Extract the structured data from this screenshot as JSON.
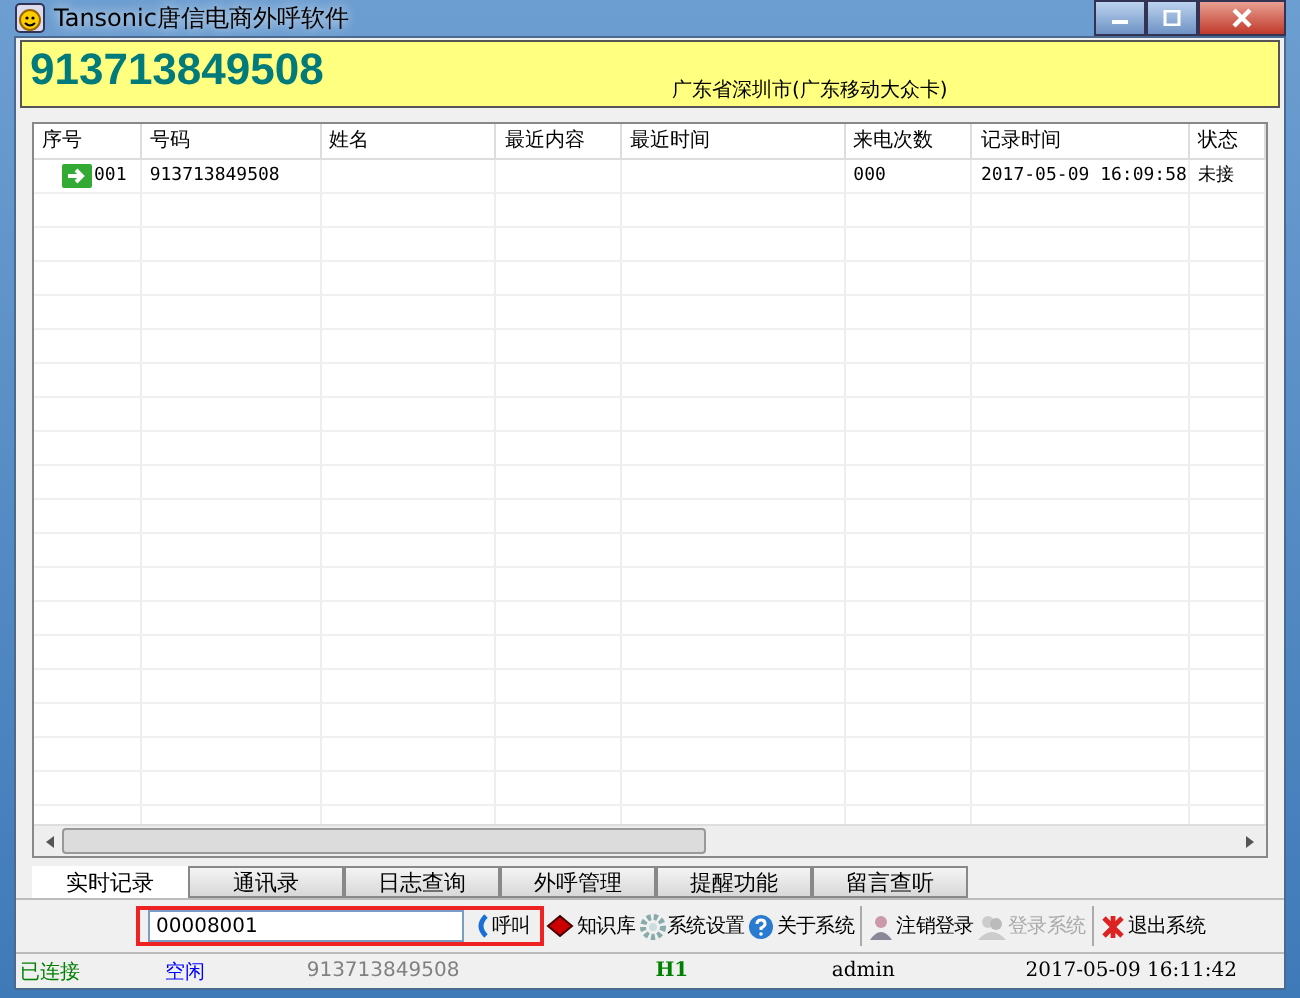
{
  "window": {
    "title": "Tansonic唐信电商外呼软件"
  },
  "caller": {
    "number": "913713849508",
    "location": "广东省深圳市(广东移动大众卡)"
  },
  "table": {
    "columns": [
      "序号",
      "号码",
      "姓名",
      "最近内容",
      "最近时间",
      "来电次数",
      "记录时间",
      "状态"
    ],
    "rows": [
      {
        "selected": false,
        "cells": [
          "001",
          "913713849508",
          "",
          "",
          "",
          "000",
          "2017-05-09 16:09:58",
          "未接"
        ]
      }
    ]
  },
  "tabs": [
    {
      "label": "实时记录",
      "selected": true
    },
    {
      "label": "通讯录",
      "selected": false
    },
    {
      "label": "日志查询",
      "selected": false
    },
    {
      "label": "外呼管理",
      "selected": false
    },
    {
      "label": "提醒功能",
      "selected": false
    },
    {
      "label": "留言查听",
      "selected": false
    }
  ],
  "dial": {
    "value": "00008001",
    "button": "呼叫"
  },
  "toolbar": [
    {
      "label": "知识库",
      "disabled": false
    },
    {
      "label": "系统设置",
      "disabled": false
    },
    {
      "label": "关于系统",
      "disabled": false
    },
    {
      "label": "注销登录",
      "disabled": false
    },
    {
      "label": "登录系统",
      "disabled": true
    },
    {
      "label": "退出系统",
      "disabled": false
    }
  ],
  "status_bar": [
    {
      "text": "已连接",
      "color": "#008000"
    },
    {
      "text": "空闲",
      "color": "#0000ff"
    },
    {
      "text": "913713849508",
      "color": "#808080"
    },
    {
      "text": "H1",
      "color": "#008000"
    },
    {
      "text": "admin",
      "color": "#000000"
    },
    {
      "text": "2017-05-09 16:11:42",
      "color": "#000000"
    }
  ]
}
